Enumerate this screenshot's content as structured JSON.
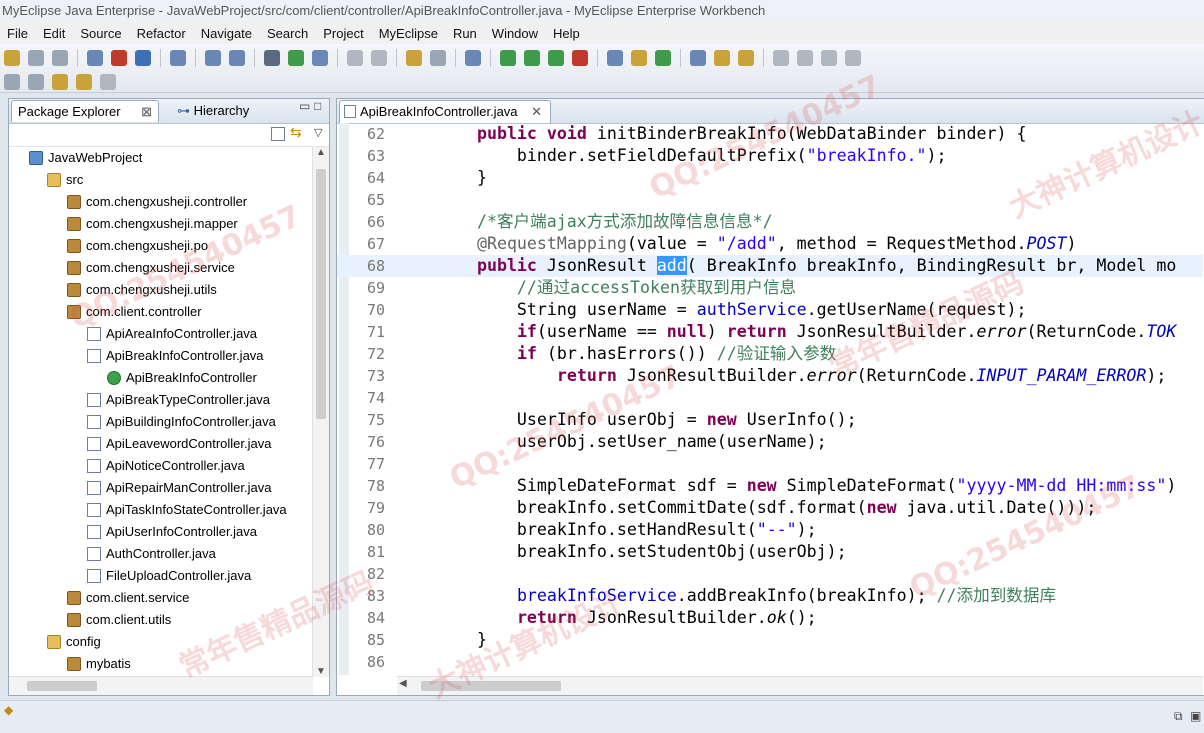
{
  "window": {
    "title": "MyEclipse Java Enterprise - JavaWebProject/src/com/client/controller/ApiBreakInfoController.java - MyEclipse Enterprise Workbench"
  },
  "menu": [
    "File",
    "Edit",
    "Source",
    "Refactor",
    "Navigate",
    "Search",
    "Project",
    "MyEclipse",
    "Run",
    "Window",
    "Help"
  ],
  "left_panel": {
    "tab_active": "Package Explorer",
    "tab_other": "Hierarchy",
    "tree": [
      {
        "label": "JavaWebProject",
        "icon": "project-icon"
      },
      {
        "label": "src",
        "icon": "source-folder-icon"
      },
      {
        "label": "com.chengxusheji.controller",
        "icon": "package-icon"
      },
      {
        "label": "com.chengxusheji.mapper",
        "icon": "package-icon"
      },
      {
        "label": "com.chengxusheji.po",
        "icon": "package-icon"
      },
      {
        "label": "com.chengxusheji.service",
        "icon": "package-icon"
      },
      {
        "label": "com.chengxusheji.utils",
        "icon": "package-icon"
      },
      {
        "label": "com.client.controller",
        "icon": "package-icon"
      },
      {
        "label": "ApiAreaInfoController.java",
        "icon": "java-file-icon"
      },
      {
        "label": "ApiBreakInfoController.java",
        "icon": "java-file-icon"
      },
      {
        "label": "ApiBreakInfoController",
        "icon": "class-icon"
      },
      {
        "label": "ApiBreakTypeController.java",
        "icon": "java-file-icon"
      },
      {
        "label": "ApiBuildingInfoController.java",
        "icon": "java-file-icon"
      },
      {
        "label": "ApiLeavewordController.java",
        "icon": "java-file-icon"
      },
      {
        "label": "ApiNoticeController.java",
        "icon": "java-file-icon"
      },
      {
        "label": "ApiRepairManController.java",
        "icon": "java-file-icon"
      },
      {
        "label": "ApiTaskInfoStateController.java",
        "icon": "java-file-icon"
      },
      {
        "label": "ApiUserInfoController.java",
        "icon": "java-file-icon"
      },
      {
        "label": "AuthController.java",
        "icon": "java-file-icon"
      },
      {
        "label": "FileUploadController.java",
        "icon": "java-file-icon"
      },
      {
        "label": "com.client.service",
        "icon": "package-icon"
      },
      {
        "label": "com.client.utils",
        "icon": "package-icon"
      },
      {
        "label": "config",
        "icon": "folder-icon"
      },
      {
        "label": "mybatis",
        "icon": "package-icon"
      }
    ]
  },
  "editor": {
    "tab_label": "ApiBreakInfoController.java",
    "lines": [
      {
        "n": "62",
        "tokens": [
          [
            "    ",
            ""
          ],
          [
            "public void",
            "kw"
          ],
          [
            " initBinderBreakInfo(WebDataBinder binder) {",
            ""
          ]
        ]
      },
      {
        "n": "63",
        "tokens": [
          [
            "        binder.setFieldDefaultPrefix(",
            ""
          ],
          [
            "\"breakInfo.\"",
            "str"
          ],
          [
            ");",
            ""
          ]
        ]
      },
      {
        "n": "64",
        "tokens": [
          [
            "    }",
            ""
          ]
        ]
      },
      {
        "n": "65",
        "tokens": [
          [
            "",
            ""
          ]
        ]
      },
      {
        "n": "66",
        "tokens": [
          [
            "    /*客户端ajax方式添加故障信息信息*/",
            "cm"
          ]
        ]
      },
      {
        "n": "67",
        "tokens": [
          [
            "    ",
            ""
          ],
          [
            "@RequestMapping",
            "ann"
          ],
          [
            "(value = ",
            ""
          ],
          [
            "\"/add\"",
            "str"
          ],
          [
            ", method = RequestMethod.",
            ""
          ],
          [
            "POST",
            "sta"
          ],
          [
            ")",
            ""
          ]
        ]
      },
      {
        "n": "68",
        "tokens": [
          [
            "    ",
            ""
          ],
          [
            "public",
            "kw"
          ],
          [
            " JsonResult ",
            ""
          ],
          [
            "add",
            "sel"
          ],
          [
            "( BreakInfo breakInfo, BindingResult br, Model mo",
            ""
          ]
        ]
      },
      {
        "n": "69",
        "tokens": [
          [
            "        //通过accessToken获取到用户信息",
            "cm"
          ]
        ]
      },
      {
        "n": "70",
        "tokens": [
          [
            "        String userName = ",
            ""
          ],
          [
            "authService",
            "fld"
          ],
          [
            ".getUserName(request);",
            ""
          ]
        ]
      },
      {
        "n": "71",
        "tokens": [
          [
            "        ",
            ""
          ],
          [
            "if",
            "kw"
          ],
          [
            "(userName == ",
            ""
          ],
          [
            "null",
            "kw"
          ],
          [
            ") ",
            ""
          ],
          [
            "return",
            "kw"
          ],
          [
            " JsonResultBuilder.",
            ""
          ],
          [
            "error",
            "itl"
          ],
          [
            "(ReturnCode.",
            ""
          ],
          [
            "TOK",
            "sta"
          ]
        ]
      },
      {
        "n": "72",
        "tokens": [
          [
            "        ",
            ""
          ],
          [
            "if",
            "kw"
          ],
          [
            " (br.hasErrors()) ",
            ""
          ],
          [
            "//验证输入参数",
            "cm"
          ]
        ]
      },
      {
        "n": "73",
        "tokens": [
          [
            "            ",
            ""
          ],
          [
            "return",
            "kw"
          ],
          [
            " JsonResultBuilder.",
            ""
          ],
          [
            "error",
            "itl"
          ],
          [
            "(ReturnCode.",
            ""
          ],
          [
            "INPUT_PARAM_ERROR",
            "sta"
          ],
          [
            ");",
            ""
          ]
        ]
      },
      {
        "n": "74",
        "tokens": [
          [
            "",
            ""
          ]
        ]
      },
      {
        "n": "75",
        "tokens": [
          [
            "        UserInfo userObj = ",
            ""
          ],
          [
            "new",
            "kw"
          ],
          [
            " UserInfo();",
            ""
          ]
        ]
      },
      {
        "n": "76",
        "tokens": [
          [
            "        userObj.setUser_name(userName);",
            ""
          ]
        ]
      },
      {
        "n": "77",
        "tokens": [
          [
            "",
            ""
          ]
        ]
      },
      {
        "n": "78",
        "tokens": [
          [
            "        SimpleDateFormat sdf = ",
            ""
          ],
          [
            "new",
            "kw"
          ],
          [
            " SimpleDateFormat(",
            ""
          ],
          [
            "\"yyyy-MM-dd HH:mm:ss\"",
            "str"
          ],
          [
            ")",
            ""
          ]
        ]
      },
      {
        "n": "79",
        "tokens": [
          [
            "        breakInfo.setCommitDate(sdf.format(",
            ""
          ],
          [
            "new",
            "kw"
          ],
          [
            " java.util.Date()));",
            ""
          ]
        ]
      },
      {
        "n": "80",
        "tokens": [
          [
            "        breakInfo.setHandResult(",
            ""
          ],
          [
            "\"--\"",
            "str"
          ],
          [
            ");",
            ""
          ]
        ]
      },
      {
        "n": "81",
        "tokens": [
          [
            "        breakInfo.setStudentObj(userObj);",
            ""
          ]
        ]
      },
      {
        "n": "82",
        "tokens": [
          [
            "",
            ""
          ]
        ]
      },
      {
        "n": "83",
        "tokens": [
          [
            "        ",
            ""
          ],
          [
            "breakInfoService",
            "fld"
          ],
          [
            ".addBreakInfo(breakInfo); ",
            ""
          ],
          [
            "//添加到数据库",
            "cm"
          ]
        ]
      },
      {
        "n": "84",
        "tokens": [
          [
            "        ",
            ""
          ],
          [
            "return",
            "kw"
          ],
          [
            " JsonResultBuilder.",
            ""
          ],
          [
            "ok",
            "itl"
          ],
          [
            "();",
            ""
          ]
        ]
      },
      {
        "n": "85",
        "tokens": [
          [
            "    }",
            ""
          ]
        ]
      },
      {
        "n": "86",
        "tokens": [
          [
            "",
            ""
          ]
        ]
      }
    ],
    "current_line": "68"
  },
  "watermarks": [
    "QQ:254540457",
    "大神计算机设计",
    "常年售精品源码"
  ]
}
